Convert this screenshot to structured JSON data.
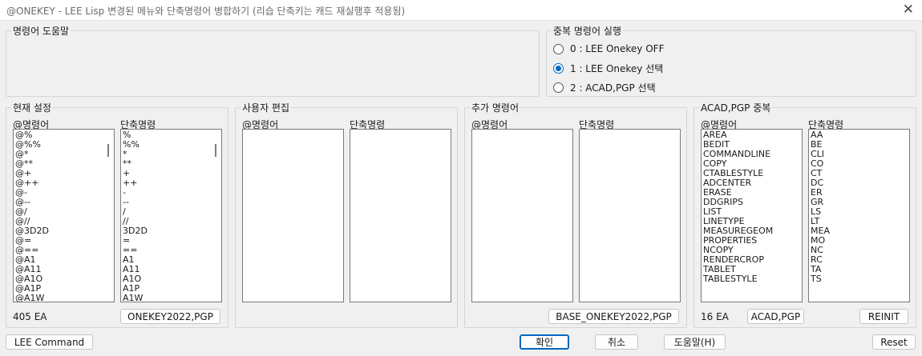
{
  "window": {
    "title": "@ONEKEY - LEE Lisp 변경된 메뉴와 단축명령어 병합하기 (리습 단축키는 캐드 재실행후 적용됨)"
  },
  "help": {
    "label": "명령어 도움말"
  },
  "duplicate_exec": {
    "label": "중복 명령어 실행",
    "options": [
      "0 : LEE Onekey OFF",
      "1 : LEE Onekey 선택",
      "2 : ACAD,PGP 선택"
    ],
    "selected_index": 1
  },
  "current": {
    "label": "현재 설정",
    "col_cmd": "@명령어",
    "col_short": "단축명령",
    "commands": [
      "@%",
      "@%%",
      "@*",
      "@**",
      "@+",
      "@++",
      "@-",
      "@--",
      "@/",
      "@//",
      "@3D2D",
      "@=",
      "@==",
      "@A1",
      "@A11",
      "@A1O",
      "@A1P",
      "@A1W"
    ],
    "shorts": [
      "%",
      "%%",
      "*",
      "**",
      "+",
      "++",
      "-",
      "--",
      "/",
      "//",
      "3D2D",
      "=",
      "==",
      "A1",
      "A11",
      "A1O",
      "A1P",
      "A1W"
    ],
    "count": "405 EA",
    "button": "ONEKEY2022,PGP"
  },
  "user_edit": {
    "label": "사용자 편집",
    "col_cmd": "@명령어",
    "col_short": "단축명령"
  },
  "added": {
    "label": "추가 명령어",
    "col_cmd": "@명령어",
    "col_short": "단축명령",
    "button": "BASE_ONEKEY2022,PGP"
  },
  "acad_dup": {
    "label": "ACAD,PGP 중복",
    "col_cmd": "@명령어",
    "col_short": "단축명령",
    "commands": [
      "AREA",
      "BEDIT",
      "COMMANDLINE",
      "COPY",
      "CTABLESTYLE",
      "ADCENTER",
      "ERASE",
      "DDGRIPS",
      "LIST",
      "LINETYPE",
      "MEASUREGEOM",
      "PROPERTIES",
      "NCOPY",
      "RENDERCROP",
      "TABLET",
      "TABLESTYLE"
    ],
    "shorts": [
      "AA",
      "BE",
      "CLI",
      "CO",
      "CT",
      "DC",
      "ER",
      "GR",
      "LS",
      "LT",
      "MEA",
      "MO",
      "NC",
      "RC",
      "TA",
      "TS"
    ],
    "count": "16 EA",
    "button_acad": "ACAD,PGP",
    "button_reinit": "REINIT"
  },
  "footer": {
    "lee_command": "LEE Command",
    "ok": "확인",
    "cancel": "취소",
    "help": "도움말(H)",
    "reset": "Reset"
  }
}
